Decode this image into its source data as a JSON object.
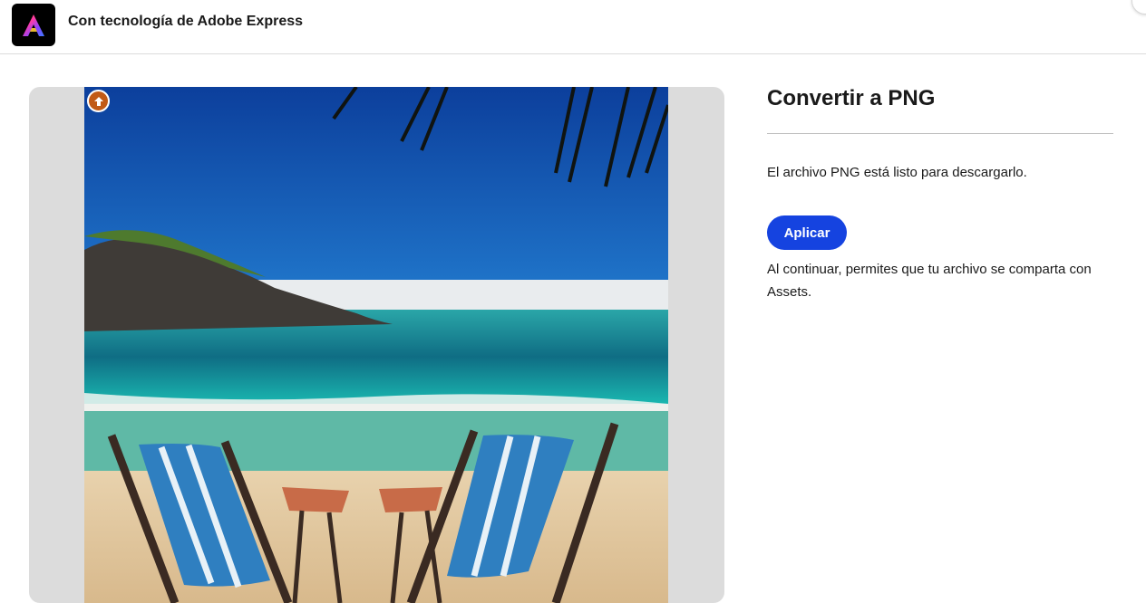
{
  "header": {
    "title": "Con tecnología de Adobe Express",
    "logo_icon": "adobe-express-logo-icon"
  },
  "preview": {
    "badge_icon": "adobe-stock-icon",
    "image_subject": "beach-chairs-image"
  },
  "panel": {
    "title": "Convertir a PNG",
    "status": "El archivo PNG está listo para descargarlo.",
    "apply_label": "Aplicar",
    "note": "Al continuar, permites que tu archivo se comparta con Assets."
  },
  "colors": {
    "accent": "#1543e0",
    "badge": "#c15a17",
    "panel_bg": "#dcdcdc"
  }
}
